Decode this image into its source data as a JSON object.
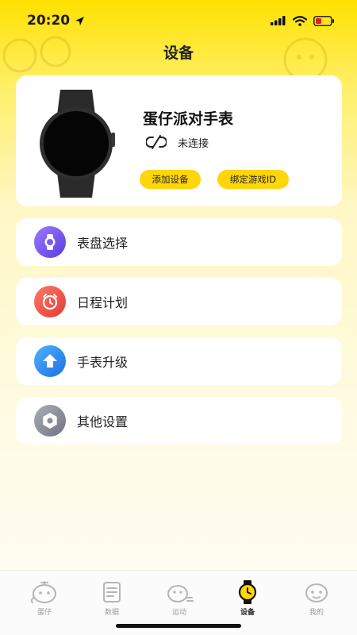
{
  "status_bar": {
    "time": "20:20"
  },
  "header": {
    "title": "设备"
  },
  "device": {
    "name": "蛋仔派对手表",
    "connection_status": "未连接",
    "add_button": "添加设备",
    "bind_button": "绑定游戏ID"
  },
  "menu": [
    {
      "label": "表盘选择",
      "icon": "watch-face-icon",
      "color": "#7b5cf0"
    },
    {
      "label": "日程计划",
      "icon": "alarm-clock-icon",
      "color": "#f2554b"
    },
    {
      "label": "手表升级",
      "icon": "upgrade-arrow-icon",
      "color": "#2d8cf0"
    },
    {
      "label": "其他设置",
      "icon": "settings-gear-icon",
      "color": "#8a8f99"
    }
  ],
  "tabs": [
    {
      "label": "蛋仔",
      "icon": "eggy-icon"
    },
    {
      "label": "数据",
      "icon": "data-document-icon"
    },
    {
      "label": "运动",
      "icon": "sport-icon"
    },
    {
      "label": "设备",
      "icon": "watch-icon",
      "active": true
    },
    {
      "label": "我的",
      "icon": "profile-icon"
    }
  ],
  "colors": {
    "accent_yellow": "#ffd60a",
    "background_top": "#ffe100"
  }
}
